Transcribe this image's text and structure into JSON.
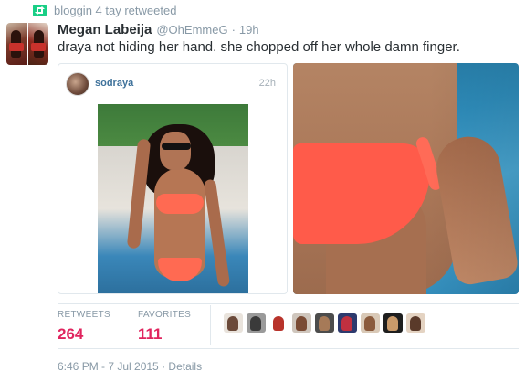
{
  "retweet_bar": {
    "label": "bloggin 4 tay retweeted",
    "icon": "retweet-icon",
    "icon_color": "#19cf86"
  },
  "tweet": {
    "author_name": "Megan Labeija",
    "handle": "@OhEmmeG",
    "separator": "·",
    "time": "19h",
    "text": "draya not hiding her hand. she chopped off her whole damn finger."
  },
  "embedded_card": {
    "username": "sodraya",
    "time": "22h"
  },
  "stats": {
    "retweets_label": "RETWEETS",
    "retweets_value": "264",
    "favorites_label": "FAVORITES",
    "favorites_value": "111",
    "value_color": "#e0245e"
  },
  "favoriters": [
    {
      "bg": "#e9e3dc",
      "fg": "#6b4a3a"
    },
    {
      "bg": "#9a9a9a",
      "fg": "#3a3a3a"
    },
    {
      "bg": "#ffffff",
      "fg": "#b8332b"
    },
    {
      "bg": "#cfc6bd",
      "fg": "#7a4b35"
    },
    {
      "bg": "#4c4c4c",
      "fg": "#a67a58"
    },
    {
      "bg": "#2d3a6e",
      "fg": "#c03040"
    },
    {
      "bg": "#d9c9b7",
      "fg": "#8a5a3c"
    },
    {
      "bg": "#1e1e1e",
      "fg": "#c99a6a"
    },
    {
      "bg": "#e4d3c2",
      "fg": "#5a3a2a"
    }
  ],
  "footer": {
    "timestamp": "6:46 PM - 7 Jul 2015",
    "separator": "·",
    "details_label": "Details"
  }
}
